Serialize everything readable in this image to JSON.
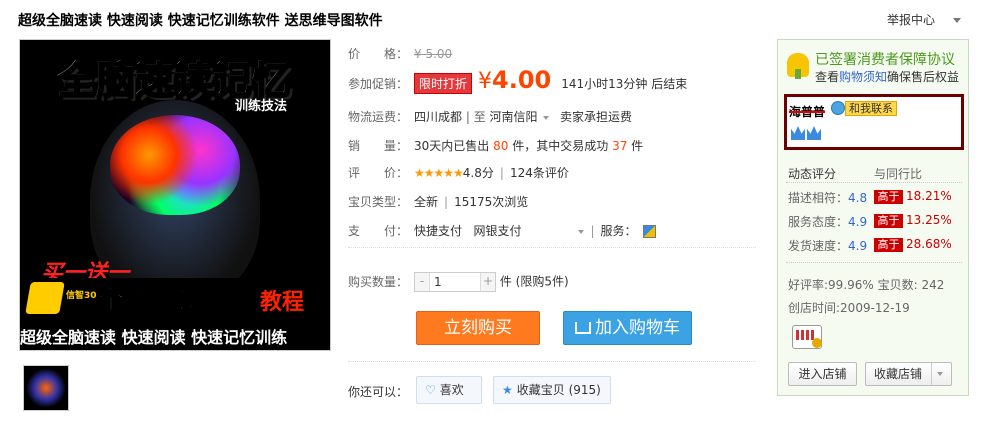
{
  "page": {
    "title": "超级全脑速读 快速阅读 快速记忆训练软件 送思维导图软件",
    "report_label": "举报中心"
  },
  "image": {
    "banner_title": "全脑速读记忆",
    "banner_sub": "训练技法",
    "promo_bogo": "买一送一",
    "brand_text": "信智30",
    "band_title": "全脑速读",
    "band_tag": "教程",
    "caption": "超级全脑速读  快速阅读  快速记忆训练"
  },
  "product": {
    "price_label": "价　　格：",
    "original_price": "¥ 5.00",
    "promo_label": "参加促销：",
    "promo_tag": "限时打折",
    "currency": "¥",
    "promo_price": "4.00",
    "countdown": "141小时13分钟 后结束",
    "shipping_label": "物流运费：",
    "ship_from": "四川成都",
    "ship_sep": "| 至",
    "ship_to": "河南信阳",
    "ship_fee": "卖家承担运费",
    "sales_label": "销　　量：",
    "sales_prefix": "30天内已售出",
    "sales_count": "80",
    "sales_mid": "件，其中交易成功",
    "sales_success": "37",
    "sales_suffix": "件",
    "rating_label": "评　　价：",
    "rating_stars": "★★★★★",
    "rating_score": "4.8分",
    "rating_sep": "|",
    "review_count": "124条评价",
    "type_label": "宝贝类型：",
    "condition": "全新",
    "type_sep": "|",
    "views": "15175次浏览",
    "pay_label": "支　　付：",
    "pay_quick": "快捷支付",
    "pay_bank": "网银支付",
    "service_label": "服务：",
    "qty_label": "购买数量：",
    "qty_minus": "-",
    "qty_value": "1",
    "qty_plus": "+",
    "qty_unit": "件 (限购5件)",
    "buy_now": "立刻购买",
    "add_cart": "加入购物车",
    "also_label": "你还可以：",
    "like_label": "喜欢",
    "favorite_label": "收藏宝贝 (915)"
  },
  "shop": {
    "guarantee_title": "已签署消费者保障协议",
    "guarantee_prefix": "查看",
    "guarantee_link": "购物须知",
    "guarantee_suffix": "确保售后权益",
    "seller_name": "海普普",
    "contact_label": "和我联系",
    "dynamic_label": "动态评分",
    "compare_label": "与同行比",
    "ratings": [
      {
        "label": "描述相符：",
        "score": "4.8",
        "compare": "高于",
        "percent": "18.21%"
      },
      {
        "label": "服务态度：",
        "score": "4.9",
        "compare": "高于",
        "percent": "13.25%"
      },
      {
        "label": "发货速度：",
        "score": "4.9",
        "compare": "高于",
        "percent": "28.68%"
      }
    ],
    "positive_rate": "好评率:99.96%  宝贝数: 242",
    "created": "创店时间:2009-12-19",
    "enter_store": "进入店铺",
    "favorite_store": "收藏店铺"
  },
  "colors": {
    "price_orange": "#ff4400",
    "buy_button": "#ff7a1f",
    "cart_button": "#3ba3e4",
    "guarantee_green": "#4b9a1e",
    "higher_red": "#cc0000"
  },
  "icons": [
    "guarantee-icon",
    "contact-icon",
    "crown-icon",
    "heart-icon",
    "star-icon",
    "cart-icon",
    "wangwang-icon",
    "service-icon"
  ]
}
